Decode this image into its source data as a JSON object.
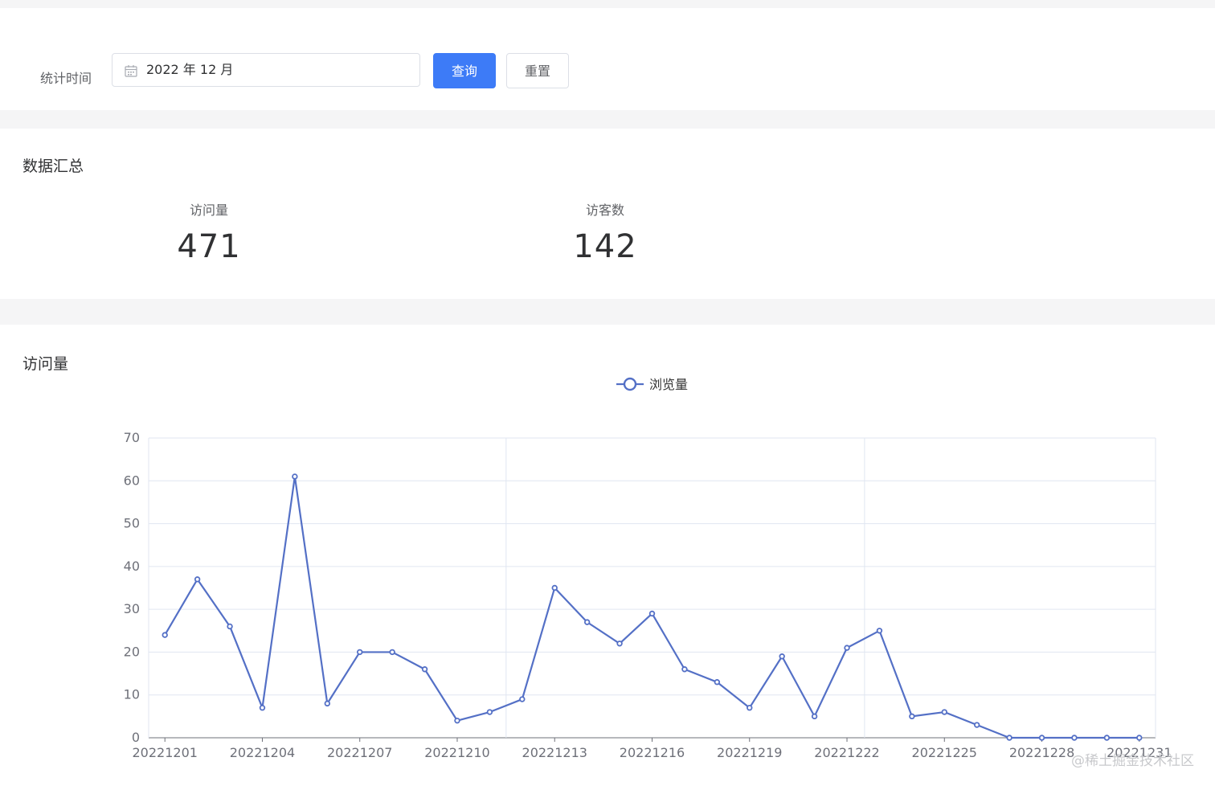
{
  "filter": {
    "label": "统计时间",
    "date_value": "2022 年 12 月",
    "query_button": "查询",
    "reset_button": "重置"
  },
  "summary": {
    "title": "数据汇总",
    "visits_label": "访问量",
    "visits_value": "471",
    "visitors_label": "访客数",
    "visitors_value": "142"
  },
  "chart_section": {
    "title": "访问量"
  },
  "colors": {
    "accent": "#3d7bf7",
    "series": "#5470c6"
  },
  "watermark": "@稀土掘金技术社区",
  "chart_data": {
    "type": "line",
    "title": "",
    "xlabel": "",
    "ylabel": "",
    "legend_position": "top-center",
    "grid": true,
    "ylim": [
      0,
      70
    ],
    "yticks": [
      0,
      10,
      20,
      30,
      40,
      50,
      60,
      70
    ],
    "x": [
      "20221201",
      "20221202",
      "20221203",
      "20221204",
      "20221205",
      "20221206",
      "20221207",
      "20221208",
      "20221209",
      "20221210",
      "20221211",
      "20221212",
      "20221213",
      "20221214",
      "20221215",
      "20221216",
      "20221217",
      "20221218",
      "20221219",
      "20221220",
      "20221221",
      "20221222",
      "20221223",
      "20221224",
      "20221225",
      "20221226",
      "20221227",
      "20221228",
      "20221229",
      "20221230",
      "20221231"
    ],
    "xtick_labels": [
      "20221201",
      "20221204",
      "20221207",
      "20221210",
      "20221213",
      "20221216",
      "20221219",
      "20221222",
      "20221225",
      "20221228",
      "20221231"
    ],
    "series": [
      {
        "name": "浏览量",
        "values": [
          24,
          37,
          26,
          7,
          61,
          8,
          20,
          20,
          16,
          4,
          6,
          9,
          35,
          27,
          22,
          29,
          16,
          13,
          7,
          19,
          5,
          21,
          25,
          5,
          6,
          3,
          0,
          0,
          0,
          0,
          0
        ]
      }
    ]
  }
}
